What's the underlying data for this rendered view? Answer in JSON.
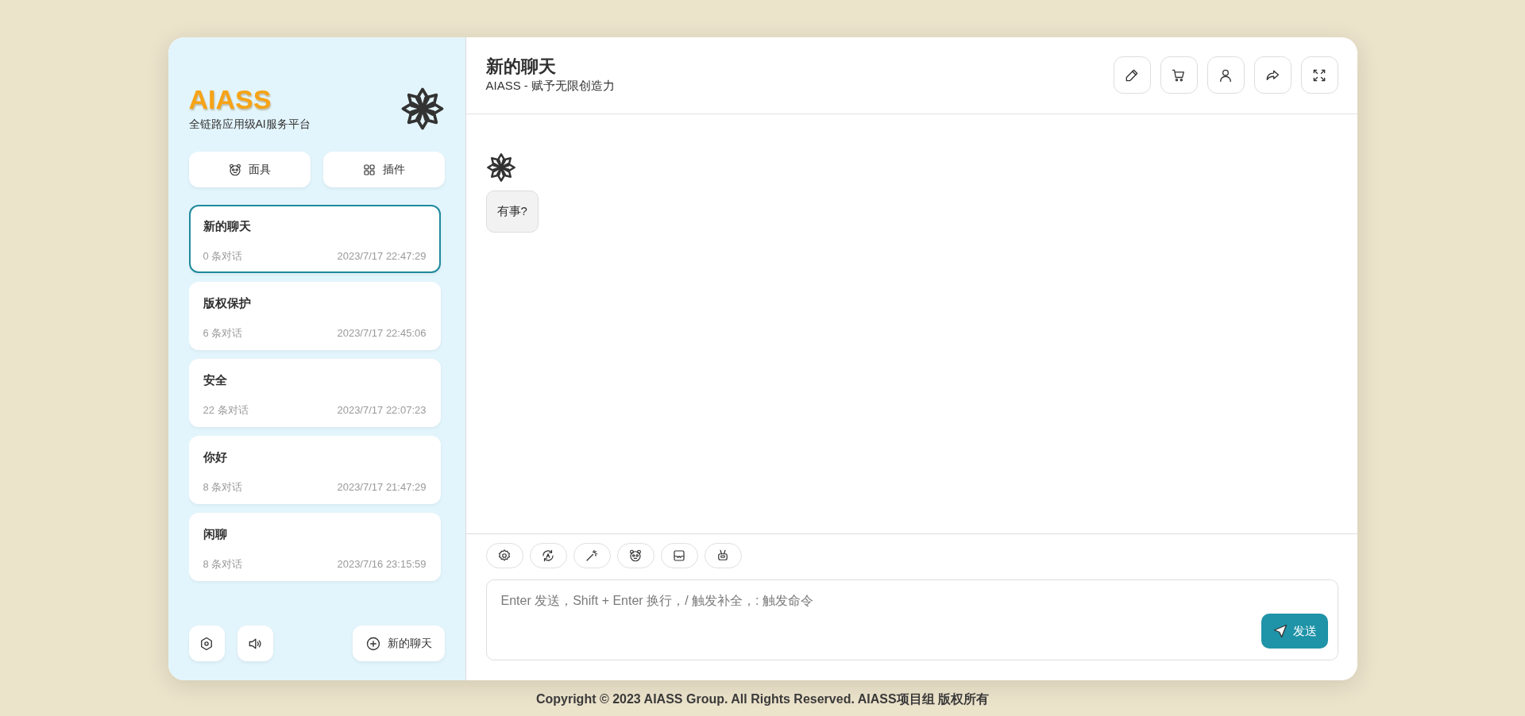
{
  "sidebar": {
    "logo": "AIASS",
    "subtitle": "全链路应用级AI服务平台",
    "buttons": [
      {
        "kind": "mask",
        "label": "面具"
      },
      {
        "kind": "plugin",
        "label": "插件"
      }
    ],
    "chats": [
      {
        "title": "新的聊天",
        "count": "0 条对话",
        "time": "2023/7/17 22:47:29",
        "selected": true
      },
      {
        "title": "版权保护",
        "count": "6 条对话",
        "time": "2023/7/17 22:45:06",
        "selected": false
      },
      {
        "title": "安全",
        "count": "22 条对话",
        "time": "2023/7/17 22:07:23",
        "selected": false
      },
      {
        "title": "你好",
        "count": "8 条对话",
        "time": "2023/7/17 21:47:29",
        "selected": false
      },
      {
        "title": "闲聊",
        "count": "8 条对话",
        "time": "2023/7/16 23:15:59",
        "selected": false
      }
    ],
    "new_chat_button": "新的聊天"
  },
  "header": {
    "title": "新的聊天",
    "subtitle": "AIASS - 赋予无限创造力"
  },
  "messages": [
    {
      "kind": "bot",
      "text": "有事?"
    }
  ],
  "input": {
    "placeholder": "Enter 发送，Shift + Enter 换行，/ 触发补全，: 触发命令",
    "send_button": "发送"
  },
  "footer": "Copyright © 2023 AIASS Group. All Rights Reserved. AIASS项目组 版权所有"
}
